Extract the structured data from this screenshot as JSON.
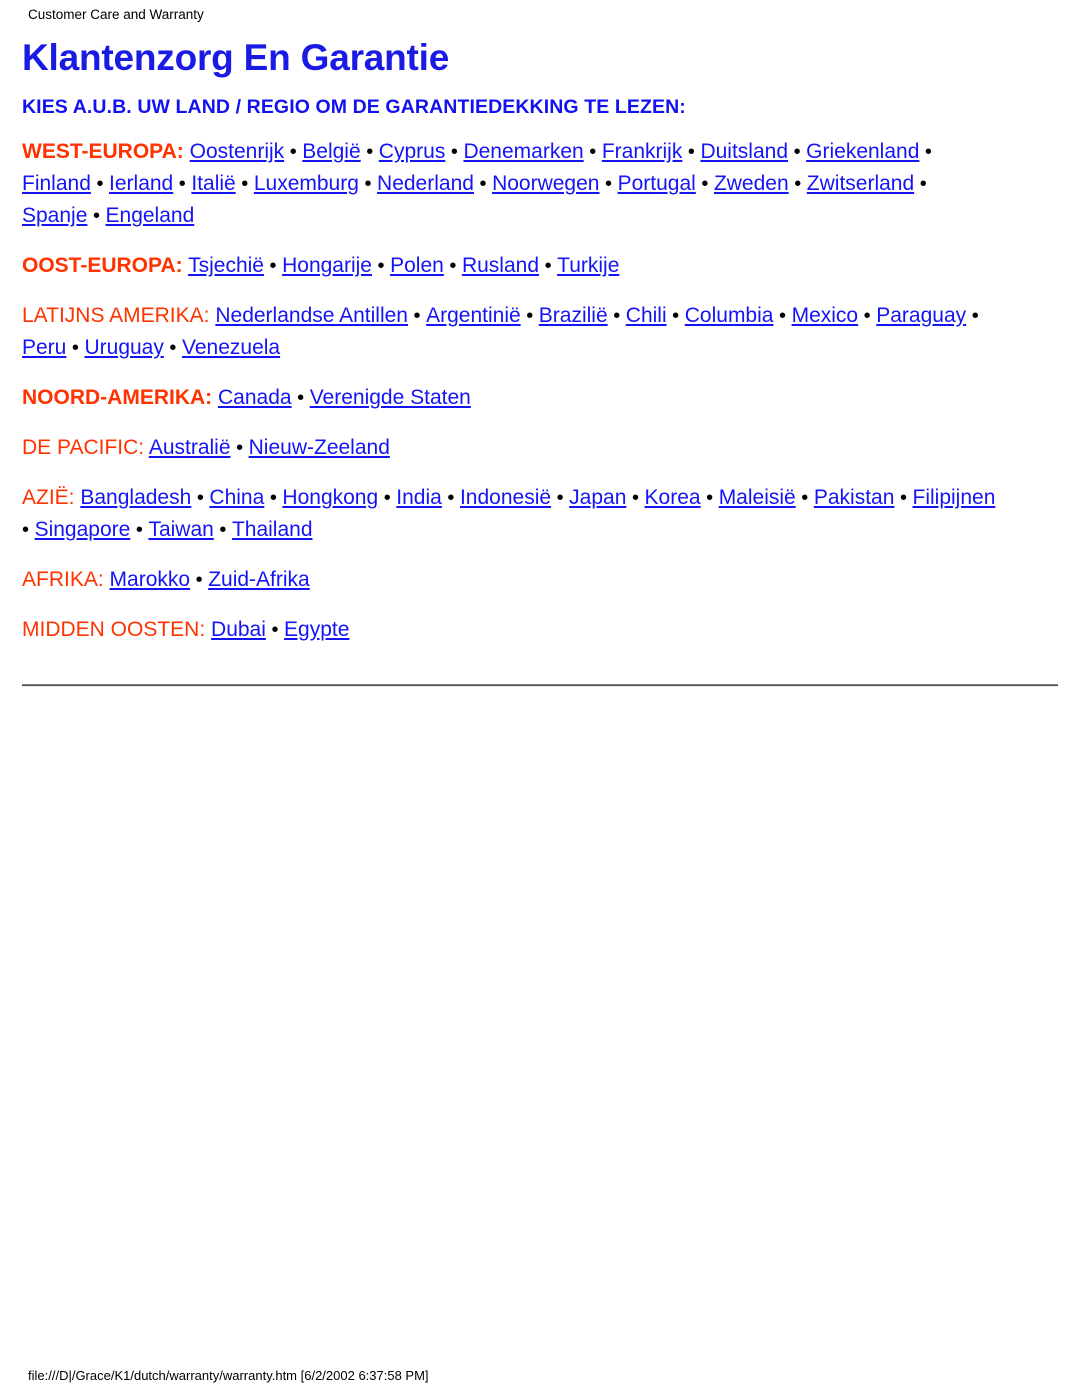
{
  "header": {
    "running_title": "Customer Care and Warranty"
  },
  "document": {
    "title": "Klantenzorg En Garantie",
    "subtitle": "KIES A.U.B. UW LAND / REGIO OM DE GARANTIEDEKKING TE LEZEN:",
    "separator": "•",
    "colors": {
      "title": "#1a1ae3",
      "subtitle": "#1212f0",
      "region_label": "#ff3300",
      "link": "#1414f5",
      "text": "#000000",
      "background": "#ffffff"
    }
  },
  "regions": [
    {
      "label": "WEST-EUROPA:",
      "bold": true,
      "countries": [
        "Oostenrijk",
        "België",
        "Cyprus",
        "Denemarken",
        "Frankrijk",
        "Duitsland",
        "Griekenland",
        "Finland",
        "Ierland",
        "Italië",
        "Luxemburg",
        "Nederland",
        "Noorwegen",
        "Portugal",
        "Zweden",
        "Zwitserland",
        "Spanje",
        "Engeland"
      ]
    },
    {
      "label": "OOST-EUROPA:",
      "bold": true,
      "countries": [
        "Tsjechië",
        "Hongarije",
        "Polen",
        "Rusland",
        "Turkije"
      ]
    },
    {
      "label": "LATIJNS AMERIKA:",
      "bold": false,
      "countries": [
        "Nederlandse Antillen",
        "Argentinië",
        "Brazilië",
        "Chili",
        "Columbia",
        "Mexico",
        "Paraguay",
        "Peru",
        "Uruguay",
        "Venezuela"
      ]
    },
    {
      "label": "NOORD-AMERIKA:",
      "bold": true,
      "countries": [
        "Canada",
        "Verenigde Staten"
      ]
    },
    {
      "label": "DE PACIFIC:",
      "bold": false,
      "countries": [
        "Australië",
        "Nieuw-Zeeland"
      ]
    },
    {
      "label": "AZIË:",
      "bold": false,
      "countries": [
        "Bangladesh",
        "China",
        "Hongkong",
        "India",
        "Indonesië",
        "Japan",
        "Korea",
        "Maleisië",
        "Pakistan",
        "Filipijnen",
        "Singapore",
        "Taiwan",
        "Thailand"
      ]
    },
    {
      "label": "AFRIKA:",
      "bold": false,
      "countries": [
        "Marokko",
        "Zuid-Afrika"
      ]
    },
    {
      "label": "MIDDEN OOSTEN:",
      "bold": false,
      "countries": [
        "Dubai",
        "Egypte"
      ]
    }
  ],
  "footer": {
    "path_and_timestamp": "file:///D|/Grace/K1/dutch/warranty/warranty.htm [6/2/2002 6:37:58 PM]"
  }
}
